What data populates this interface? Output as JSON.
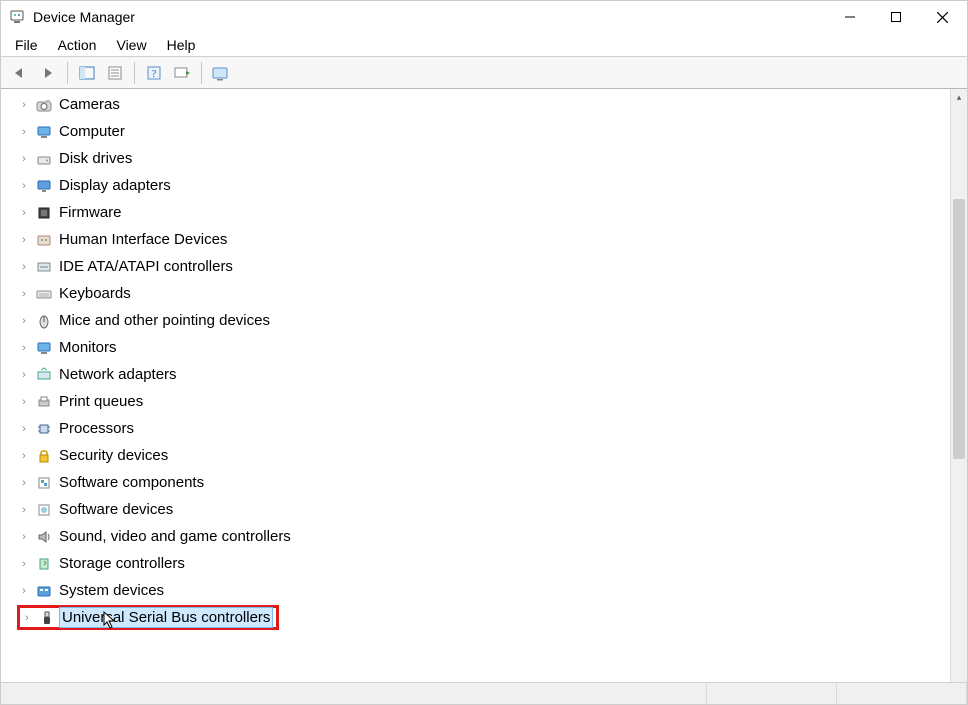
{
  "window": {
    "title": "Device Manager"
  },
  "menu": {
    "items": [
      "File",
      "Action",
      "View",
      "Help"
    ]
  },
  "toolbar": {
    "buttons": [
      "back",
      "forward",
      "show-hide-tree",
      "properties",
      "help",
      "scan",
      "monitor"
    ]
  },
  "tree": {
    "nodes": [
      {
        "icon": "camera-icon",
        "label": "Cameras"
      },
      {
        "icon": "computer-icon",
        "label": "Computer"
      },
      {
        "icon": "disk-icon",
        "label": "Disk drives"
      },
      {
        "icon": "display-icon",
        "label": "Display adapters"
      },
      {
        "icon": "firmware-icon",
        "label": "Firmware"
      },
      {
        "icon": "hid-icon",
        "label": "Human Interface Devices"
      },
      {
        "icon": "ide-icon",
        "label": "IDE ATA/ATAPI controllers"
      },
      {
        "icon": "keyboard-icon",
        "label": "Keyboards"
      },
      {
        "icon": "mouse-icon",
        "label": "Mice and other pointing devices"
      },
      {
        "icon": "monitor-icon",
        "label": "Monitors"
      },
      {
        "icon": "network-icon",
        "label": "Network adapters"
      },
      {
        "icon": "printer-icon",
        "label": "Print queues"
      },
      {
        "icon": "cpu-icon",
        "label": "Processors"
      },
      {
        "icon": "security-icon",
        "label": "Security devices"
      },
      {
        "icon": "swcomp-icon",
        "label": "Software components"
      },
      {
        "icon": "swdev-icon",
        "label": "Software devices"
      },
      {
        "icon": "sound-icon",
        "label": "Sound, video and game controllers"
      },
      {
        "icon": "storage-icon",
        "label": "Storage controllers"
      },
      {
        "icon": "system-icon",
        "label": "System devices"
      },
      {
        "icon": "usb-icon",
        "label": "Universal Serial Bus controllers",
        "selected": true,
        "highlighted": true
      }
    ]
  }
}
